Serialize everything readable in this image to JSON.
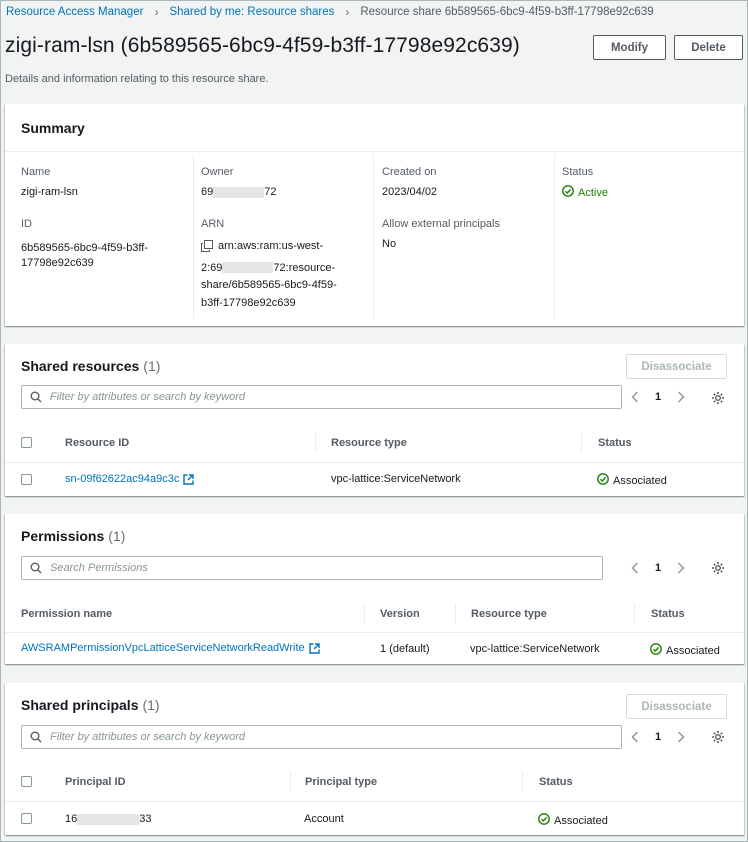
{
  "breadcrumb": {
    "items": [
      "Resource Access Manager",
      "Shared by me: Resource shares"
    ],
    "current": "Resource share 6b589565-6bc9-4f59-b3ff-17798e92c639"
  },
  "header": {
    "title": "zigi-ram-lsn (6b589565-6bc9-4f59-b3ff-17798e92c639)",
    "description": "Details and information relating to this resource share.",
    "modify_label": "Modify",
    "delete_label": "Delete"
  },
  "summary": {
    "title": "Summary",
    "name_label": "Name",
    "name_value": "zigi-ram-lsn",
    "id_label": "ID",
    "id_value_line1": "6b589565-6bc9-4f59-b3ff-",
    "id_value_line2": "17798e92c639",
    "owner_label": "Owner",
    "owner_prefix": "69",
    "owner_suffix": "72",
    "arn_label": "ARN",
    "arn_line1": "arn:aws:ram:us-west-",
    "arn_line2_prefix": "2:69",
    "arn_line2_suffix": "72:resource-",
    "arn_line3": "share/6b589565-6bc9-4f59-",
    "arn_line4": "b3ff-17798e92c639",
    "created_label": "Created on",
    "created_value": "2023/04/02",
    "external_label": "Allow external principals",
    "external_value": "No",
    "status_label": "Status",
    "status_value": "Active"
  },
  "shared_resources": {
    "title": "Shared resources",
    "count": "(1)",
    "disassociate_label": "Disassociate",
    "search_placeholder": "Filter by attributes or search by keyword",
    "page": "1",
    "columns": [
      "Resource ID",
      "Resource type",
      "Status"
    ],
    "rows": [
      {
        "resource_id": "sn-09f62622ac94a9c3c",
        "resource_type": "vpc-lattice:ServiceNetwork",
        "status": "Associated"
      }
    ]
  },
  "permissions": {
    "title": "Permissions",
    "count": "(1)",
    "search_placeholder": "Search Permissions",
    "page": "1",
    "columns": [
      "Permission name",
      "Version",
      "Resource type",
      "Status"
    ],
    "rows": [
      {
        "name": "AWSRAMPermissionVpcLatticeServiceNetworkReadWrite",
        "version": "1 (default)",
        "resource_type": "vpc-lattice:ServiceNetwork",
        "status": "Associated"
      }
    ]
  },
  "shared_principals": {
    "title": "Shared principals",
    "count": "(1)",
    "disassociate_label": "Disassociate",
    "search_placeholder": "Filter by attributes or search by keyword",
    "page": "1",
    "columns": [
      "Principal ID",
      "Principal type",
      "Status"
    ],
    "rows": [
      {
        "principal_prefix": "16",
        "principal_suffix": "33",
        "principal_type": "Account",
        "status": "Associated"
      }
    ]
  },
  "colors": {
    "link": "#0073bb",
    "success": "#1d8102",
    "background": "#f2f3f3"
  }
}
